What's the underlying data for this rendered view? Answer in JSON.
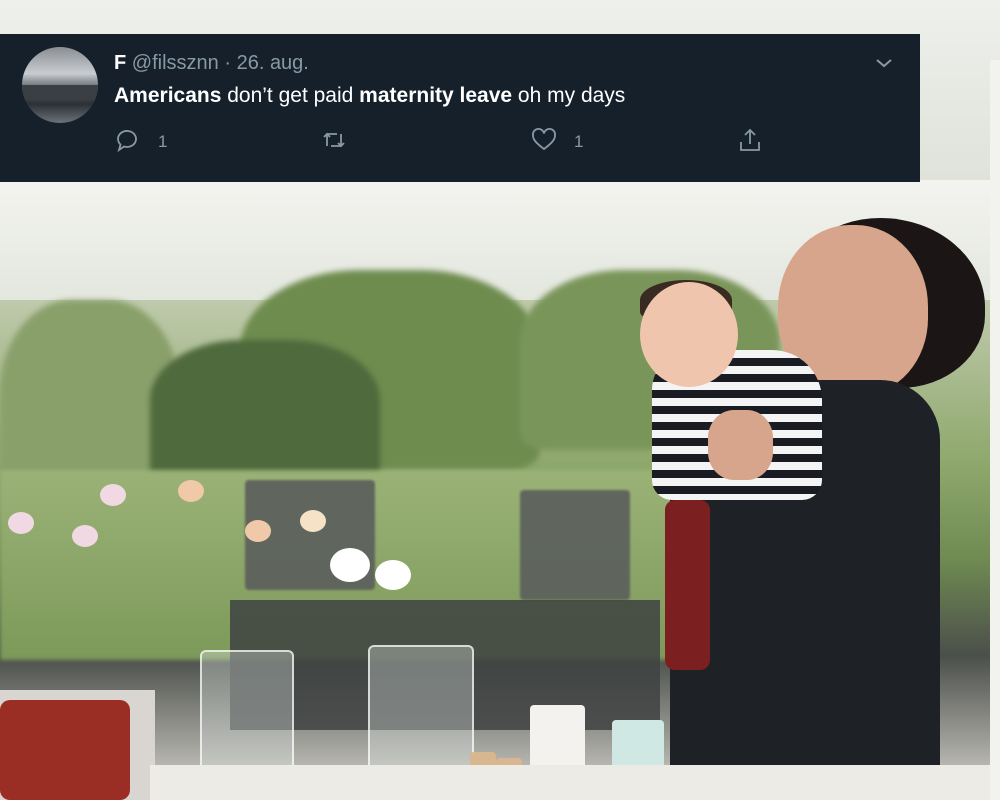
{
  "tweet": {
    "display_name": "F",
    "handle": "@filssznn",
    "separator": "·",
    "date": "26. aug.",
    "text_segments": [
      {
        "text": "Americans",
        "bold": true
      },
      {
        "text": " don’t get paid ",
        "bold": false
      },
      {
        "text": "maternity leave",
        "bold": true
      },
      {
        "text": " oh my days",
        "bold": false
      }
    ],
    "actions": {
      "reply_count": "1",
      "retweet_count": "",
      "like_count": "1"
    },
    "icons": {
      "menu": "chevron-down-icon",
      "reply": "speech-bubble-icon",
      "retweet": "retweet-arrows-icon",
      "like": "heart-icon",
      "share": "share-upload-icon"
    },
    "colors": {
      "background": "#15202b",
      "text": "#ffffff",
      "secondary_text": "#8899a6"
    }
  },
  "photo": {
    "subject": "photo"
  }
}
